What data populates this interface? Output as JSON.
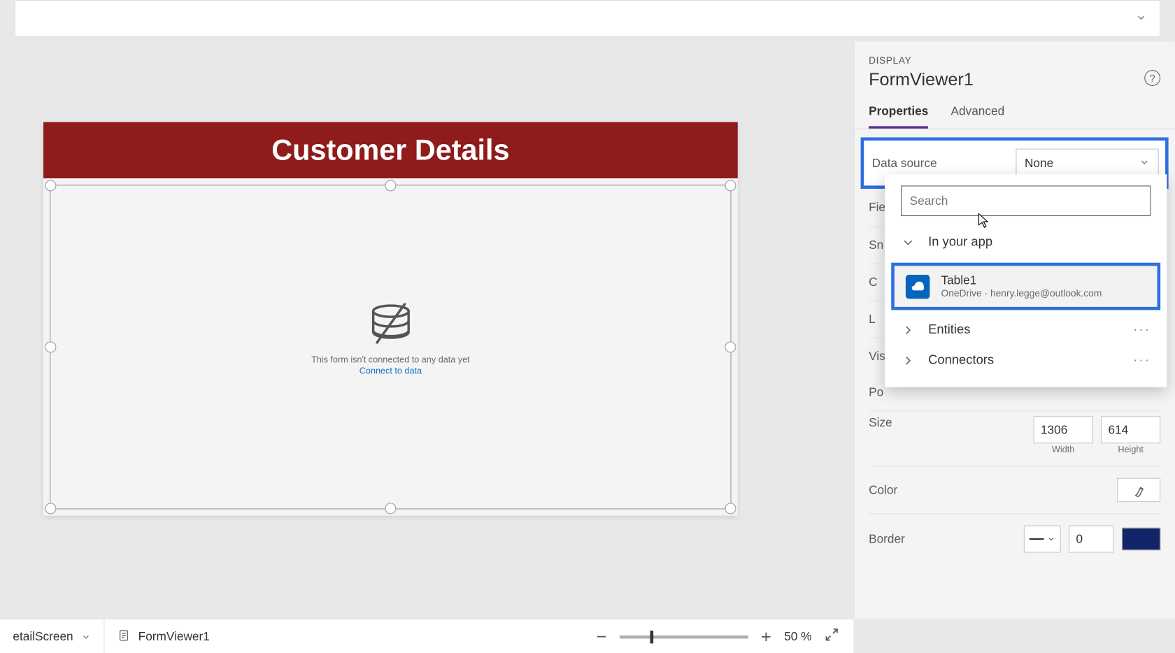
{
  "app_screen": {
    "header_title": "Customer Details",
    "empty_message": "This form isn't connected to any data yet",
    "connect_link": "Connect to data"
  },
  "right_panel": {
    "eyebrow": "DISPLAY",
    "title": "FormViewer1",
    "tabs": {
      "properties": "Properties",
      "advanced": "Advanced"
    },
    "datasource_label": "Data source",
    "datasource_value": "None",
    "rows_cut": {
      "fie": "Fie",
      "sn": "Sn",
      "c": "C",
      "l": "L",
      "vis": "Vis",
      "po": "Po"
    },
    "size_label": "Size",
    "width_value": "1306",
    "height_value": "614",
    "width_label": "Width",
    "height_label": "Height",
    "color_label": "Color",
    "border_label": "Border",
    "border_value": "0"
  },
  "datasource_popup": {
    "search_placeholder": "Search",
    "in_your_app": "In your app",
    "table_name": "Table1",
    "table_subtitle": "OneDrive - henry.legge@outlook.com",
    "entities": "Entities",
    "connectors": "Connectors",
    "more": "···"
  },
  "bottom_bar": {
    "screen_label": "etailScreen",
    "control_label": "FormViewer1",
    "zoom_pct": "50  %"
  }
}
